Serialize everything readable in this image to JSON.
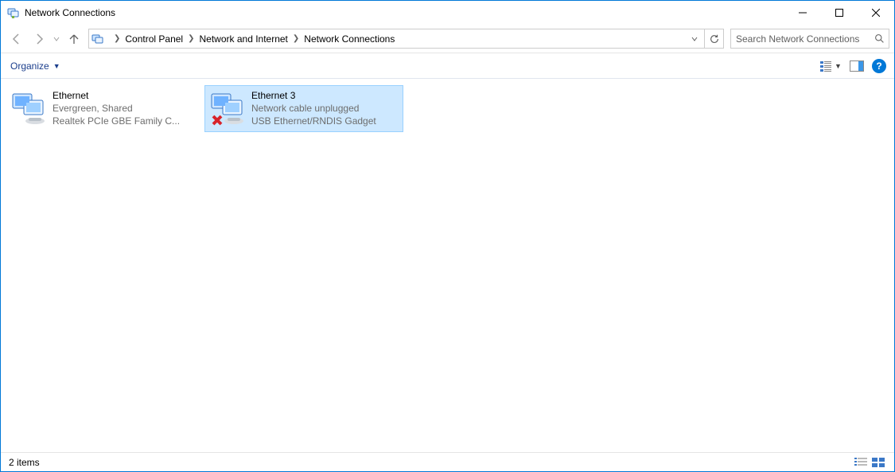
{
  "window": {
    "title": "Network Connections"
  },
  "nav": {
    "breadcrumbs": [
      "Control Panel",
      "Network and Internet",
      "Network Connections"
    ]
  },
  "search": {
    "placeholder": "Search Network Connections"
  },
  "commandbar": {
    "organize_label": "Organize"
  },
  "connections": [
    {
      "name": "Ethernet",
      "status": "Evergreen, Shared",
      "device": "Realtek PCIe GBE Family C...",
      "unplugged": false,
      "selected": false
    },
    {
      "name": "Ethernet 3",
      "status": "Network cable unplugged",
      "device": "USB Ethernet/RNDIS Gadget",
      "unplugged": true,
      "selected": true
    }
  ],
  "statusbar": {
    "item_count_label": "2 items"
  }
}
